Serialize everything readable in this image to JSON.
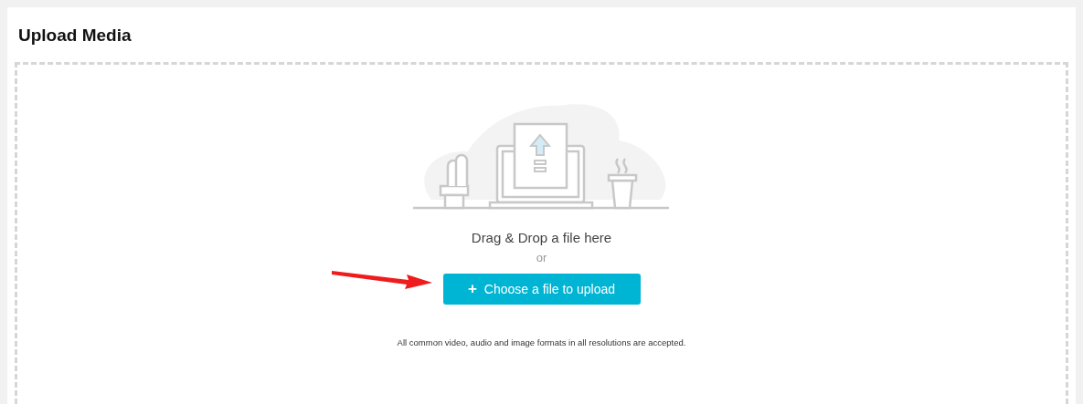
{
  "panel": {
    "title": "Upload Media"
  },
  "dropzone": {
    "prompt": "Drag & Drop a file here",
    "separator": "or",
    "button": {
      "icon": "+",
      "label": "Choose a file to upload"
    },
    "note": "All common video, audio and image formats in all resolutions are accepted."
  }
}
